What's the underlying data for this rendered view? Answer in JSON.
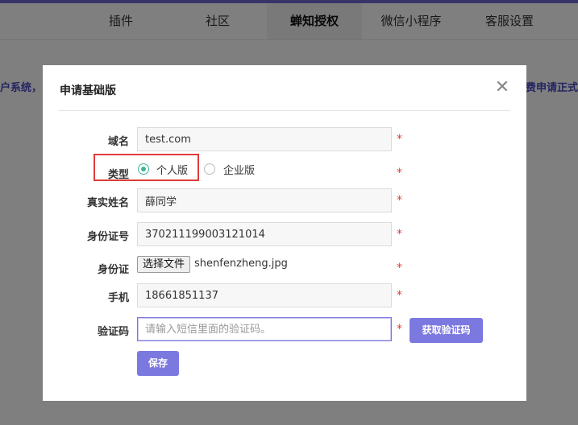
{
  "tabs": [
    {
      "label": "插件"
    },
    {
      "label": "社区"
    },
    {
      "label": "蝉知授权"
    },
    {
      "label": "微信小程序"
    },
    {
      "label": "客服设置"
    }
  ],
  "background": {
    "notice_left": "户系统，",
    "notice_right": "费申请正式"
  },
  "modal": {
    "title": "申请基础版",
    "close_icon": "close-icon",
    "fields": {
      "domain": {
        "label": "域名",
        "value": "test.com"
      },
      "type": {
        "label": "类型",
        "options": [
          {
            "label": "个人版",
            "checked": true
          },
          {
            "label": "企业版",
            "checked": false
          }
        ]
      },
      "realname": {
        "label": "真实姓名",
        "value": "薛同学"
      },
      "idnumber": {
        "label": "身份证号",
        "value": "370211199003121014"
      },
      "idcard": {
        "label": "身份证",
        "button": "选择文件",
        "filename": "shenfenzheng.jpg"
      },
      "phone": {
        "label": "手机",
        "value": "18661851137"
      },
      "code": {
        "label": "验证码",
        "placeholder": "请输入短信里面的验证码。",
        "value": ""
      }
    },
    "required_mark": "*",
    "get_code_button": "获取验证码",
    "save_button": "保存"
  },
  "colors": {
    "accent": "#7b78e0",
    "required": "#e23b3b",
    "radio_checked": "#3fb39a",
    "highlight_border": "#e03a3a"
  }
}
